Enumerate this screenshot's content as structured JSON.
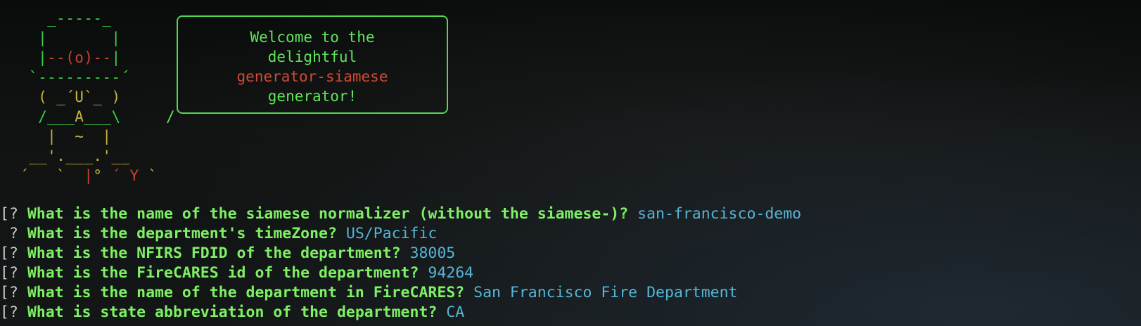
{
  "ascii_art": {
    "lines": [
      [
        {
          "t": "   _-----_",
          "c": "grn"
        }
      ],
      [
        {
          "t": "  |       |",
          "c": "grn"
        }
      ],
      [
        {
          "t": "  |",
          "c": "grn"
        },
        {
          "t": "--(o)--",
          "c": "red"
        },
        {
          "t": "|",
          "c": "grn"
        }
      ],
      [
        {
          "t": " `---------´",
          "c": "grn"
        }
      ],
      [
        {
          "t": "  ( ",
          "c": "yel"
        },
        {
          "t": "_´U`_",
          "c": "yel"
        },
        {
          "t": " )",
          "c": "yel"
        }
      ],
      [
        {
          "t": "  /___",
          "c": "grn"
        },
        {
          "t": "A",
          "c": "yel"
        },
        {
          "t": "___\\",
          "c": "grn"
        }
      ],
      [
        {
          "t": "   |  ",
          "c": "yel"
        },
        {
          "t": "~",
          "c": "yel"
        },
        {
          "t": "  |",
          "c": "yel"
        }
      ],
      [
        {
          "t": " __",
          "c": "yel"
        },
        {
          "t": "'.___.'",
          "c": "yel"
        },
        {
          "t": "__",
          "c": "yel"
        }
      ],
      [
        {
          "t": "´   `  ",
          "c": "yel"
        },
        {
          "t": "|",
          "c": "red"
        },
        {
          "t": "° ",
          "c": "yel"
        },
        {
          "t": "´ Y",
          "c": "red"
        },
        {
          "t": " `",
          "c": "yel"
        }
      ]
    ]
  },
  "welcome": {
    "line1": "Welcome to the",
    "line2": "delightful",
    "line3": "generator-siamese",
    "line4": "generator!",
    "tail": "/"
  },
  "prompts": [
    {
      "marker": "[?",
      "question": "What is the name of the siamese normalizer (without the siamese-)?",
      "answer": "san-francisco-demo"
    },
    {
      "marker": " ?",
      "question": "What is the department's timeZone?",
      "answer": "US/Pacific"
    },
    {
      "marker": "[?",
      "question": "What is the NFIRS FDID of the department?",
      "answer": "38005"
    },
    {
      "marker": "[?",
      "question": "What is the FireCARES id of the department?",
      "answer": "94264"
    },
    {
      "marker": "[?",
      "question": "What is the name of the department in FireCARES?",
      "answer": "San Francisco Fire Department"
    },
    {
      "marker": "[?",
      "question": "What is state abbreviation of the department?",
      "answer": "CA"
    }
  ],
  "colors": {
    "background": "#0c0d0d",
    "green": "#5ee55a",
    "question_green": "#7ef064",
    "red": "#d24a36",
    "yellow": "#c8b53d",
    "answer_blue": "#54b6d6"
  }
}
